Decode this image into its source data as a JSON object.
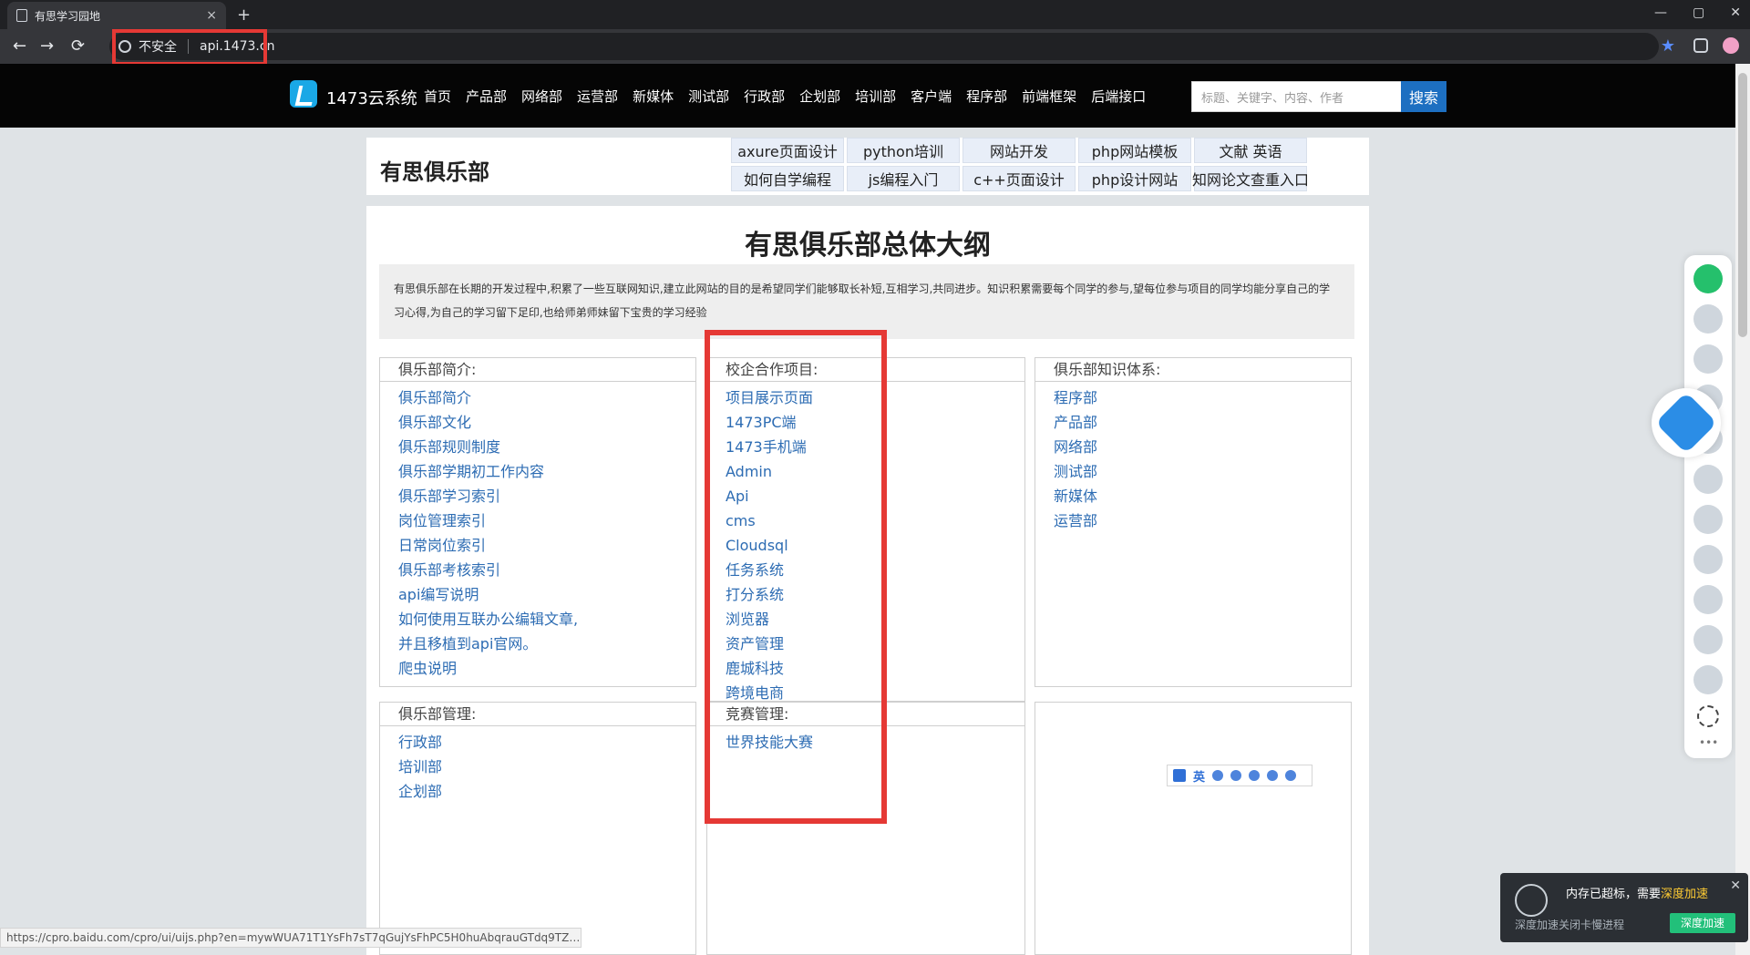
{
  "browser": {
    "tab_title": "有思学习园地",
    "tab_close": "×",
    "new_tab": "+",
    "address_security": "不安全",
    "address_url": "api.1473.cn",
    "window_controls": [
      "—",
      "▢",
      "✕"
    ],
    "icons": {
      "back": "←",
      "forward": "→",
      "reload": "⟳",
      "star": "★"
    }
  },
  "site_header": {
    "brand": "1473云系统",
    "nav": [
      "首页",
      "产品部",
      "网络部",
      "运营部",
      "新媒体",
      "测试部",
      "行政部",
      "企划部",
      "培训部",
      "客户端",
      "程序部",
      "前端框架",
      "后端接口"
    ],
    "search_placeholder": "标题、关键字、内容、作者",
    "search_button": "搜索"
  },
  "top_card": {
    "title": "有思俱乐部",
    "tags_row1": [
      "axure页面设计",
      "python培训",
      "网站开发",
      "php网站模板",
      "文献 英语"
    ],
    "tags_row2": [
      "如何自学编程",
      "js编程入门",
      "c++页面设计",
      "php设计网站",
      "知网论文查重入口"
    ]
  },
  "outline": {
    "title": "有思俱乐部总体大纲",
    "intro": "有思俱乐部在长期的开发过程中,积累了一些互联网知识,建立此网站的目的是希望同学们能够取长补短,互相学习,共同进步。知识积累需要每个同学的参与,望每位参与项目的同学均能分享自己的学习心得,为自己的学习留下足印,也给师弟师妹留下宝贵的学习经验",
    "sections": {
      "club_intro": {
        "heading": "俱乐部简介:",
        "items": [
          "俱乐部简介",
          "俱乐部文化",
          "俱乐部规则制度",
          "俱乐部学期初工作内容",
          "俱乐部学习索引",
          "岗位管理索引",
          "日常岗位索引",
          "俱乐部考核索引",
          "api编写说明",
          "如何使用互联办公编辑文章,\n并且移植到api官网。",
          "爬虫说明"
        ]
      },
      "school_enterprise": {
        "heading": "校企合作项目:",
        "items": [
          "项目展示页面",
          "1473PC端",
          "1473手机端",
          "Admin",
          "Api",
          "cms",
          "Cloudsql",
          "任务系统",
          "打分系统",
          "浏览器",
          "资产管理",
          "鹿城科技",
          "跨境电商"
        ]
      },
      "knowledge_system": {
        "heading": "俱乐部知识体系:",
        "items": [
          "程序部",
          "产品部",
          "网络部",
          "测试部",
          "新媒体",
          "运营部"
        ]
      },
      "club_management": {
        "heading": "俱乐部管理:",
        "items": [
          "行政部",
          "培训部",
          "企划部"
        ]
      },
      "competition": {
        "heading": "竞赛管理:",
        "items": [
          "世界技能大赛"
        ]
      }
    }
  },
  "status_bar": {
    "url": "https://cpro.baidu.com/cpro/ui/uijs.php?en=mywWUA71T1YsFh7sT7qGujYsFhPC5H0huAbqrauGTdq9TZ0qn..."
  },
  "popup": {
    "message_prefix": "内存已超标，需要",
    "message_accent": "深度加速",
    "hint": "深度加速关闭卡慢进程",
    "button": "深度加速",
    "close": "✕"
  },
  "ime": {
    "label": "英"
  },
  "colors": {
    "highlight": "#e53935",
    "link": "#2d6cb3",
    "header_bg": "#050505",
    "search_button": "#1d6fc1"
  }
}
